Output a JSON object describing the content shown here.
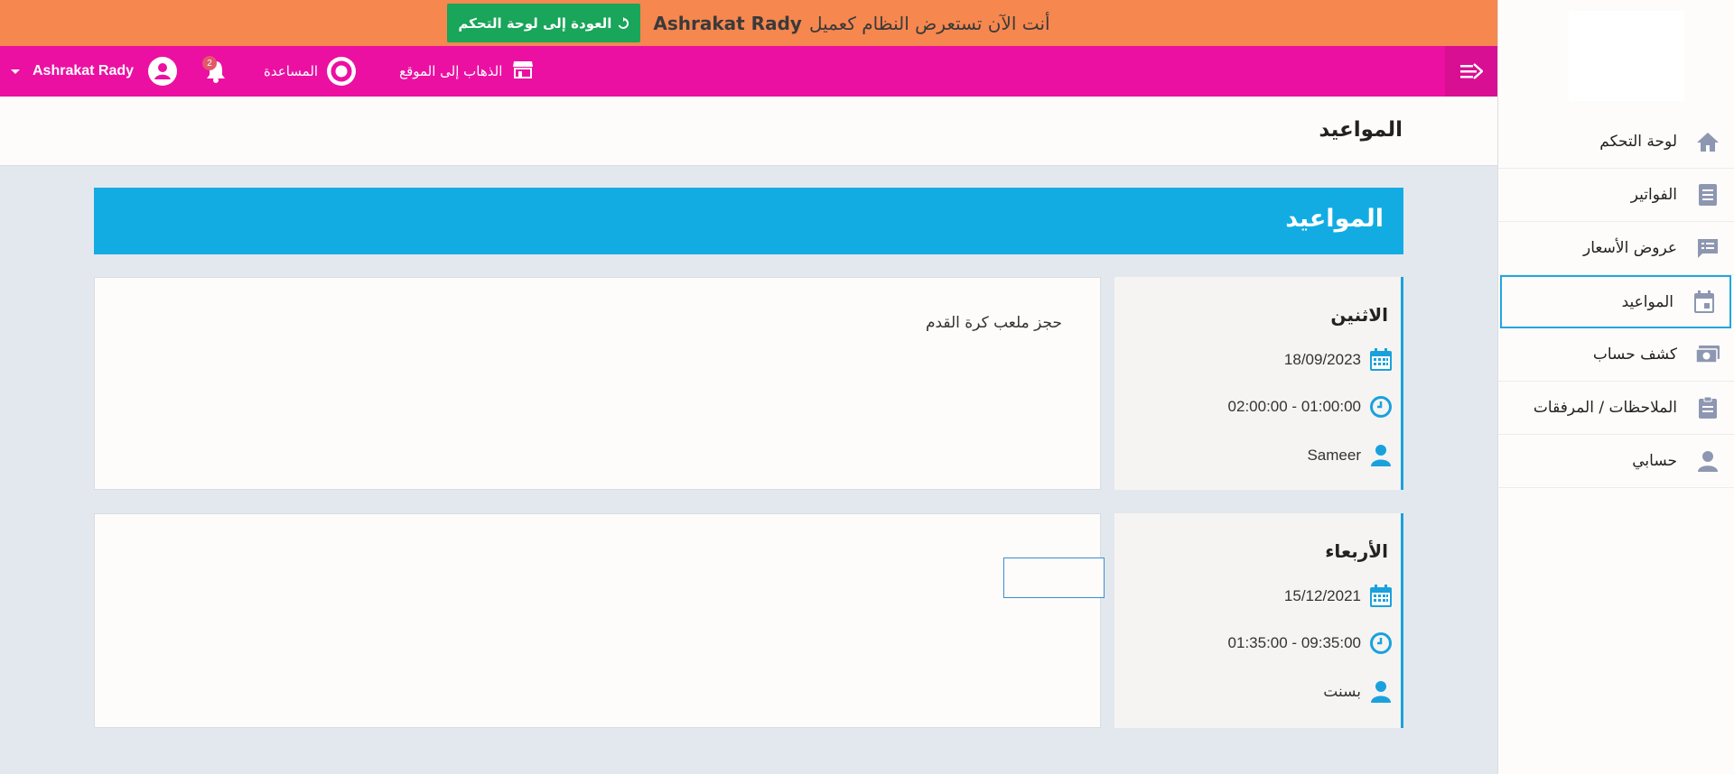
{
  "banner": {
    "prefix": "أنت الآن تستعرض النظام كعميل",
    "client_name": "Ashrakat Rady",
    "back_label": "العودة إلى لوحة التحكم"
  },
  "navbar": {
    "user_name": "Ashrakat Rady",
    "notification_count": "2",
    "help_label": "المساعدة",
    "site_label": "الذهاب إلى الموقع"
  },
  "page": {
    "title": "المواعيد"
  },
  "sidebar": {
    "items": [
      {
        "label": "لوحة التحكم",
        "icon": "home-icon"
      },
      {
        "label": "الفواتير",
        "icon": "invoice-icon"
      },
      {
        "label": "عروض الأسعار",
        "icon": "quote-icon"
      },
      {
        "label": "المواعيد",
        "icon": "calendar-icon",
        "active": true
      },
      {
        "label": "كشف حساب",
        "icon": "money-icon"
      },
      {
        "label": "الملاحظات / المرفقات",
        "icon": "clipboard-icon"
      },
      {
        "label": "حسابي",
        "icon": "user-icon"
      }
    ]
  },
  "content": {
    "section_title": "المواعيد",
    "appointments": [
      {
        "day": "الاثنين",
        "date": "18/09/2023",
        "time": "02:00:00 - 01:00:00",
        "person": "Sameer",
        "description": "حجز ملعب كرة القدم"
      },
      {
        "day": "الأربعاء",
        "date": "15/12/2021",
        "time": "01:35:00 - 09:35:00",
        "person": "بسنت",
        "description": ""
      }
    ]
  },
  "colors": {
    "banner": "#f5874f",
    "navbar": "#eb10a2",
    "accent": "#13ace2",
    "back_button": "#19a55a"
  }
}
